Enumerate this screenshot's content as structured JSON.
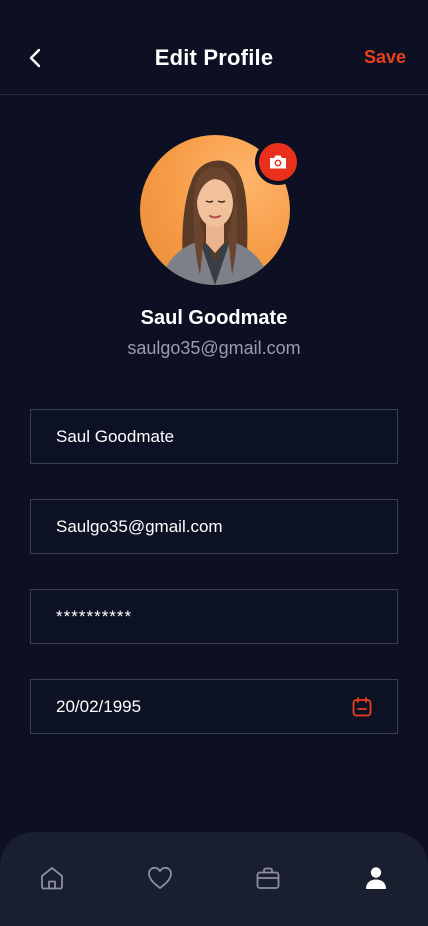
{
  "header": {
    "title": "Edit Profile",
    "save_label": "Save",
    "back_icon": "chevron-left-icon"
  },
  "profile": {
    "name": "Saul Goodmate",
    "email": "saulgo35@gmail.com",
    "camera_icon": "camera-icon"
  },
  "form": {
    "name_value": "Saul Goodmate",
    "email_value": "Saulgo35@gmail.com",
    "password_value": "**********",
    "birthdate_value": "20/02/1995",
    "calendar_icon": "calendar-icon"
  },
  "bottom_nav": {
    "items": [
      {
        "icon": "home-icon",
        "active": false
      },
      {
        "icon": "heart-icon",
        "active": false
      },
      {
        "icon": "bag-icon",
        "active": false
      },
      {
        "icon": "user-icon",
        "active": true
      }
    ]
  },
  "colors": {
    "background": "#0c1022",
    "accent": "#e8401c",
    "nav_background": "#1a1f2f",
    "inactive_icon": "#8a8e9e"
  }
}
